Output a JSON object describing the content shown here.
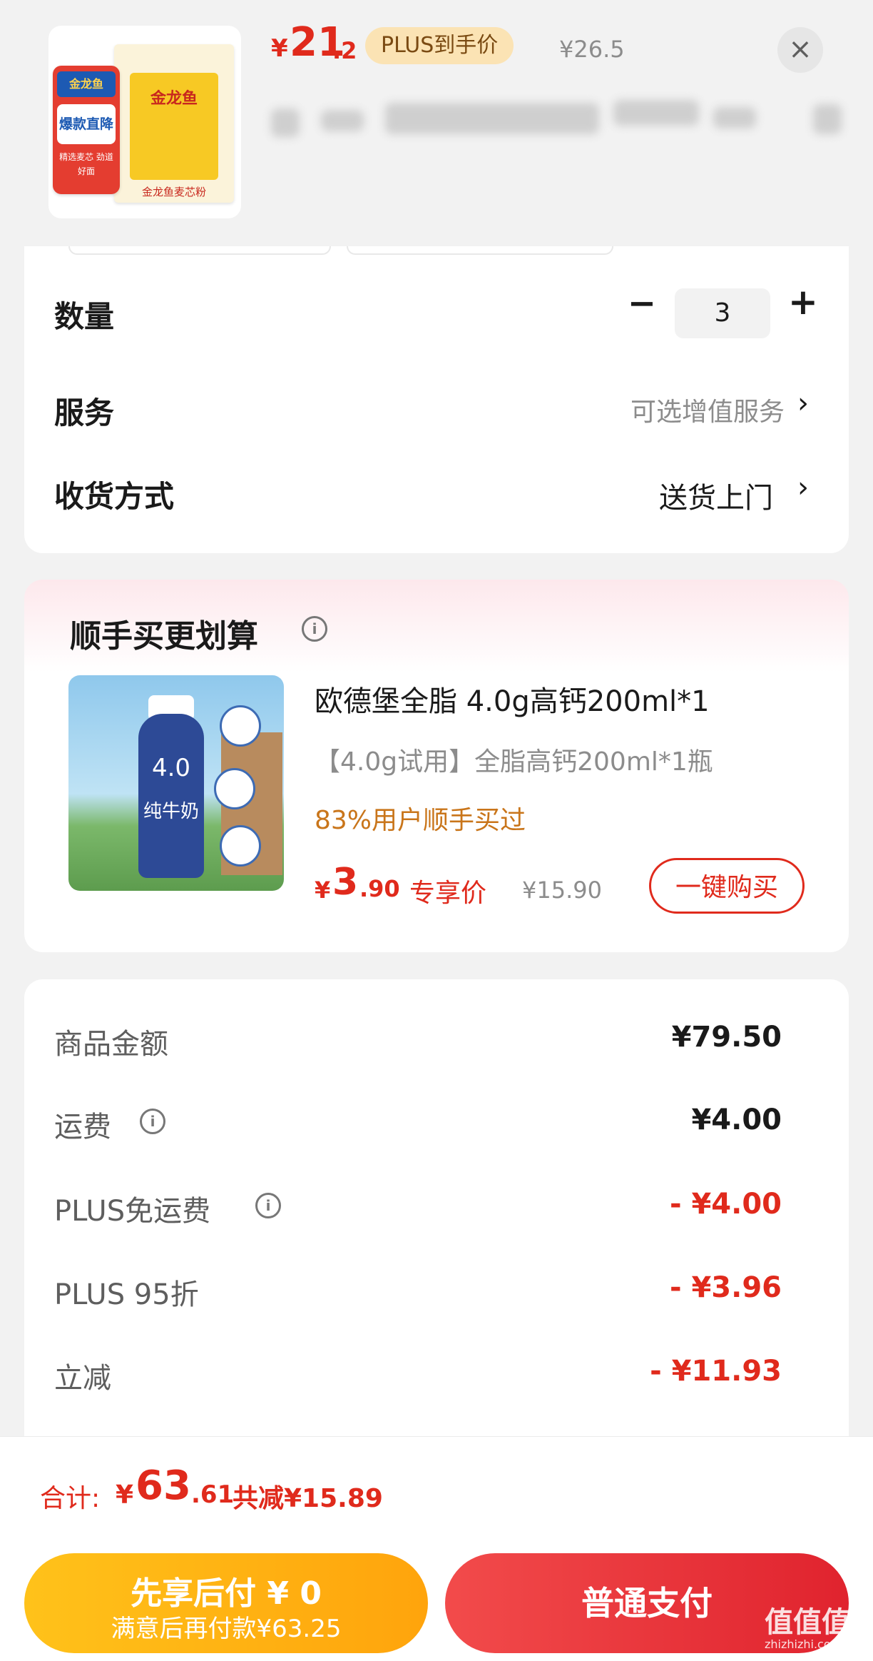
{
  "header": {
    "product_brand": "金龙鱼",
    "product_brand_sub": "金龙鱼麦芯粉",
    "promo_top": "金龙鱼",
    "promo_main": "爆款直降",
    "promo_sub": "精选麦芯 劲道好面",
    "price_currency": "¥",
    "price_integer": "21",
    "price_decimal": ".2",
    "plus_badge": "PLUS到手价",
    "original_price": "¥26.5",
    "close_icon": "×"
  },
  "options": {
    "quantity_label": "数量",
    "quantity_value": "3",
    "minus": "−",
    "plus": "+",
    "service_label": "服务",
    "service_value": "可选增值服务",
    "delivery_label": "收货方式",
    "delivery_value": "送货上门",
    "chevron": "›"
  },
  "addon": {
    "title": "顺手买更划算",
    "info_icon": "i",
    "product_name": "欧德堡全脂 4.0g高钙200ml*1",
    "spec": "【4.0g试用】全脂高钙200ml*1瓶",
    "bought_text": "83%用户顺手买过",
    "price_currency": "¥",
    "price_integer": "3",
    "price_decimal": ".90",
    "price_tag": "专享价",
    "original_price": "¥15.90",
    "buy_button": "一键购买",
    "image_text_main": "4.0",
    "image_text_sub": "纯牛奶"
  },
  "summary": {
    "rows": [
      {
        "label": "商品金额",
        "value": "¥79.50",
        "style": "dark",
        "info": false
      },
      {
        "label": "运费",
        "value": "¥4.00",
        "style": "dark",
        "info": true
      },
      {
        "label": "PLUS免运费",
        "value": "- ¥4.00",
        "style": "red",
        "info": true
      },
      {
        "label": "PLUS 95折",
        "value": "- ¥3.96",
        "style": "red",
        "info": false
      },
      {
        "label": "立减",
        "value": "- ¥11.93",
        "style": "red",
        "info": false
      }
    ]
  },
  "total": {
    "label": "合计:",
    "currency": "¥",
    "integer": "63",
    "decimal": ".61",
    "saved": "共减¥15.89"
  },
  "actions": {
    "pay_later_main": "先享后付 ¥ 0",
    "pay_later_sub": "满意后再付款¥63.25",
    "pay_normal": "普通支付",
    "watermark": "值值值",
    "watermark_sub": "zhizhizhi.com"
  },
  "colors": {
    "accent_red": "#e02a1c",
    "plus_badge_bg": "#fbe3b4",
    "bought_orange": "#c9751a",
    "pay_later_yellow": "#ffb213",
    "pay_normal_red": "#e6282f"
  }
}
